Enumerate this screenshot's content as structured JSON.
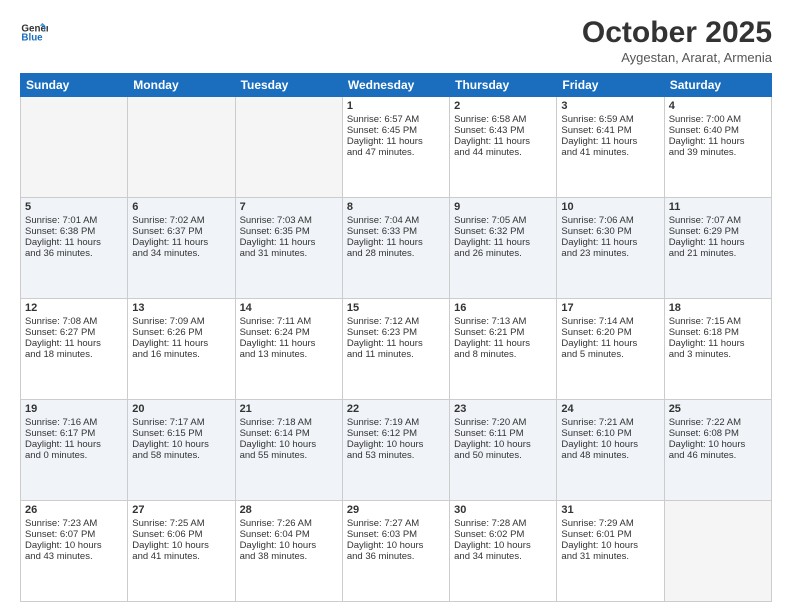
{
  "header": {
    "logo_general": "General",
    "logo_blue": "Blue",
    "month_title": "October 2025",
    "location": "Aygestan, Ararat, Armenia"
  },
  "days_of_week": [
    "Sunday",
    "Monday",
    "Tuesday",
    "Wednesday",
    "Thursday",
    "Friday",
    "Saturday"
  ],
  "weeks": [
    [
      {
        "num": "",
        "info": ""
      },
      {
        "num": "",
        "info": ""
      },
      {
        "num": "",
        "info": ""
      },
      {
        "num": "1",
        "info": "Sunrise: 6:57 AM\nSunset: 6:45 PM\nDaylight: 11 hours\nand 47 minutes."
      },
      {
        "num": "2",
        "info": "Sunrise: 6:58 AM\nSunset: 6:43 PM\nDaylight: 11 hours\nand 44 minutes."
      },
      {
        "num": "3",
        "info": "Sunrise: 6:59 AM\nSunset: 6:41 PM\nDaylight: 11 hours\nand 41 minutes."
      },
      {
        "num": "4",
        "info": "Sunrise: 7:00 AM\nSunset: 6:40 PM\nDaylight: 11 hours\nand 39 minutes."
      }
    ],
    [
      {
        "num": "5",
        "info": "Sunrise: 7:01 AM\nSunset: 6:38 PM\nDaylight: 11 hours\nand 36 minutes."
      },
      {
        "num": "6",
        "info": "Sunrise: 7:02 AM\nSunset: 6:37 PM\nDaylight: 11 hours\nand 34 minutes."
      },
      {
        "num": "7",
        "info": "Sunrise: 7:03 AM\nSunset: 6:35 PM\nDaylight: 11 hours\nand 31 minutes."
      },
      {
        "num": "8",
        "info": "Sunrise: 7:04 AM\nSunset: 6:33 PM\nDaylight: 11 hours\nand 28 minutes."
      },
      {
        "num": "9",
        "info": "Sunrise: 7:05 AM\nSunset: 6:32 PM\nDaylight: 11 hours\nand 26 minutes."
      },
      {
        "num": "10",
        "info": "Sunrise: 7:06 AM\nSunset: 6:30 PM\nDaylight: 11 hours\nand 23 minutes."
      },
      {
        "num": "11",
        "info": "Sunrise: 7:07 AM\nSunset: 6:29 PM\nDaylight: 11 hours\nand 21 minutes."
      }
    ],
    [
      {
        "num": "12",
        "info": "Sunrise: 7:08 AM\nSunset: 6:27 PM\nDaylight: 11 hours\nand 18 minutes."
      },
      {
        "num": "13",
        "info": "Sunrise: 7:09 AM\nSunset: 6:26 PM\nDaylight: 11 hours\nand 16 minutes."
      },
      {
        "num": "14",
        "info": "Sunrise: 7:11 AM\nSunset: 6:24 PM\nDaylight: 11 hours\nand 13 minutes."
      },
      {
        "num": "15",
        "info": "Sunrise: 7:12 AM\nSunset: 6:23 PM\nDaylight: 11 hours\nand 11 minutes."
      },
      {
        "num": "16",
        "info": "Sunrise: 7:13 AM\nSunset: 6:21 PM\nDaylight: 11 hours\nand 8 minutes."
      },
      {
        "num": "17",
        "info": "Sunrise: 7:14 AM\nSunset: 6:20 PM\nDaylight: 11 hours\nand 5 minutes."
      },
      {
        "num": "18",
        "info": "Sunrise: 7:15 AM\nSunset: 6:18 PM\nDaylight: 11 hours\nand 3 minutes."
      }
    ],
    [
      {
        "num": "19",
        "info": "Sunrise: 7:16 AM\nSunset: 6:17 PM\nDaylight: 11 hours\nand 0 minutes."
      },
      {
        "num": "20",
        "info": "Sunrise: 7:17 AM\nSunset: 6:15 PM\nDaylight: 10 hours\nand 58 minutes."
      },
      {
        "num": "21",
        "info": "Sunrise: 7:18 AM\nSunset: 6:14 PM\nDaylight: 10 hours\nand 55 minutes."
      },
      {
        "num": "22",
        "info": "Sunrise: 7:19 AM\nSunset: 6:12 PM\nDaylight: 10 hours\nand 53 minutes."
      },
      {
        "num": "23",
        "info": "Sunrise: 7:20 AM\nSunset: 6:11 PM\nDaylight: 10 hours\nand 50 minutes."
      },
      {
        "num": "24",
        "info": "Sunrise: 7:21 AM\nSunset: 6:10 PM\nDaylight: 10 hours\nand 48 minutes."
      },
      {
        "num": "25",
        "info": "Sunrise: 7:22 AM\nSunset: 6:08 PM\nDaylight: 10 hours\nand 46 minutes."
      }
    ],
    [
      {
        "num": "26",
        "info": "Sunrise: 7:23 AM\nSunset: 6:07 PM\nDaylight: 10 hours\nand 43 minutes."
      },
      {
        "num": "27",
        "info": "Sunrise: 7:25 AM\nSunset: 6:06 PM\nDaylight: 10 hours\nand 41 minutes."
      },
      {
        "num": "28",
        "info": "Sunrise: 7:26 AM\nSunset: 6:04 PM\nDaylight: 10 hours\nand 38 minutes."
      },
      {
        "num": "29",
        "info": "Sunrise: 7:27 AM\nSunset: 6:03 PM\nDaylight: 10 hours\nand 36 minutes."
      },
      {
        "num": "30",
        "info": "Sunrise: 7:28 AM\nSunset: 6:02 PM\nDaylight: 10 hours\nand 34 minutes."
      },
      {
        "num": "31",
        "info": "Sunrise: 7:29 AM\nSunset: 6:01 PM\nDaylight: 10 hours\nand 31 minutes."
      },
      {
        "num": "",
        "info": ""
      }
    ]
  ]
}
